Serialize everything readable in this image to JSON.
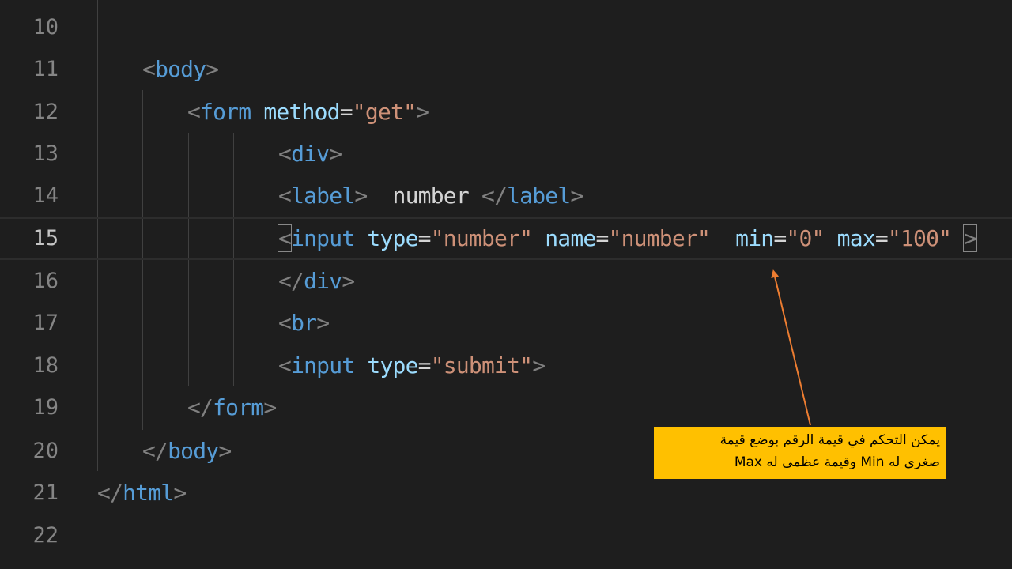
{
  "editor": {
    "lines": [
      {
        "number": "10"
      },
      {
        "number": "11"
      },
      {
        "number": "12"
      },
      {
        "number": "13"
      },
      {
        "number": "14"
      },
      {
        "number": "15"
      },
      {
        "number": "16"
      },
      {
        "number": "17"
      },
      {
        "number": "18"
      },
      {
        "number": "19"
      },
      {
        "number": "20"
      },
      {
        "number": "21"
      },
      {
        "number": "22"
      }
    ],
    "active_line": "15",
    "tokens": {
      "lt": "<",
      "gt": ">",
      "lt_slash": "</",
      "eq": "=",
      "body": "body",
      "form": "form",
      "div": "div",
      "label": "label",
      "input": "input",
      "br": "br",
      "html": "html",
      "method": "method",
      "type": "type",
      "name": "name",
      "min": "min",
      "max": "max",
      "get_val": "\"get\"",
      "number_val": "\"number\"",
      "min_val": "\"0\"",
      "max_val": "\"100\"",
      "submit_val": "\"submit\"",
      "label_text": "number"
    }
  },
  "callout": {
    "line1": "يمكن التحكم في قيمة الرقم بوضع قيمة",
    "line2": "صغرى له Min وقيمة عظمى له Max",
    "background": "#ffc000"
  },
  "colors": {
    "background": "#1e1e1e",
    "tag": "#569cd6",
    "attribute": "#9cdcfe",
    "string": "#ce9178",
    "bracket": "#808080",
    "arrow": "#ed7d31"
  }
}
